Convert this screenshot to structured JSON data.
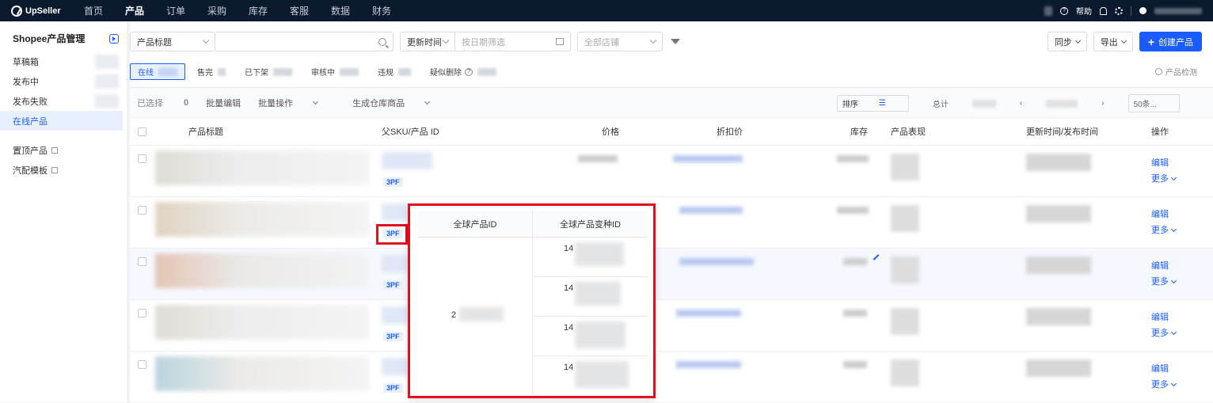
{
  "topbar": {
    "brand": "UpSeller",
    "nav": [
      "首页",
      "产品",
      "订单",
      "采购",
      "库存",
      "客服",
      "数据",
      "财务"
    ],
    "active_nav": "产品",
    "help_label": "帮助"
  },
  "sidebar": {
    "title": "Shopee产品管理",
    "items": [
      {
        "label": "草稿箱",
        "active": false
      },
      {
        "label": "发布中",
        "active": false
      },
      {
        "label": "发布失败",
        "active": false
      },
      {
        "label": "在线产品",
        "active": true
      }
    ],
    "links": [
      {
        "label": "置顶产品"
      },
      {
        "label": "汽配模板"
      }
    ]
  },
  "filters": {
    "field_select": "产品标题",
    "time_select": "更新时间",
    "date_placeholder": "按日期筛选",
    "store_placeholder": "全部店铺"
  },
  "actions": {
    "sync": "同步",
    "export": "导出",
    "create": "创建产品"
  },
  "tabs": [
    {
      "label": "在线",
      "active": true
    },
    {
      "label": "售完",
      "active": false
    },
    {
      "label": "已下架",
      "active": false
    },
    {
      "label": "审核中",
      "active": false
    },
    {
      "label": "违规",
      "active": false
    },
    {
      "label": "疑似删除",
      "active": false
    }
  ],
  "product_check": "产品检测",
  "bulk": {
    "selected": "已选择",
    "selected_count": "0",
    "bulk_edit": "批量编辑",
    "bulk_ops": "批量操作",
    "gen_warehouse": "生成仓库商品",
    "sort": "排序",
    "total": "总计",
    "page_size": "50条..."
  },
  "columns": {
    "title": "产品标题",
    "sku": "父SKU/产品 ID",
    "price": "价格",
    "discount": "折扣价",
    "stock": "库存",
    "performance": "产品表现",
    "time": "更新时间/发布时间",
    "ops": "操作"
  },
  "rows": [
    {
      "tag": "3PF",
      "edit": "编辑",
      "more": "更多"
    },
    {
      "tag": "3PF",
      "edit": "编辑",
      "more": "更多"
    },
    {
      "tag": "3PF",
      "edit": "编辑",
      "more": "更多"
    },
    {
      "tag": "3PF",
      "edit": "编辑",
      "more": "更多"
    },
    {
      "tag": "3PF",
      "edit": "编辑",
      "more": "更多"
    }
  ],
  "popup": {
    "col_global_id": "全球产品ID",
    "col_variant_id": "全球产品变种ID",
    "global_id_prefix": "2",
    "variant_prefixes": [
      "14",
      "14",
      "14",
      "14"
    ]
  },
  "colors": {
    "accent": "#1a5cff",
    "highlight_red": "#e0101e",
    "topbar": "#0b1a2e"
  }
}
